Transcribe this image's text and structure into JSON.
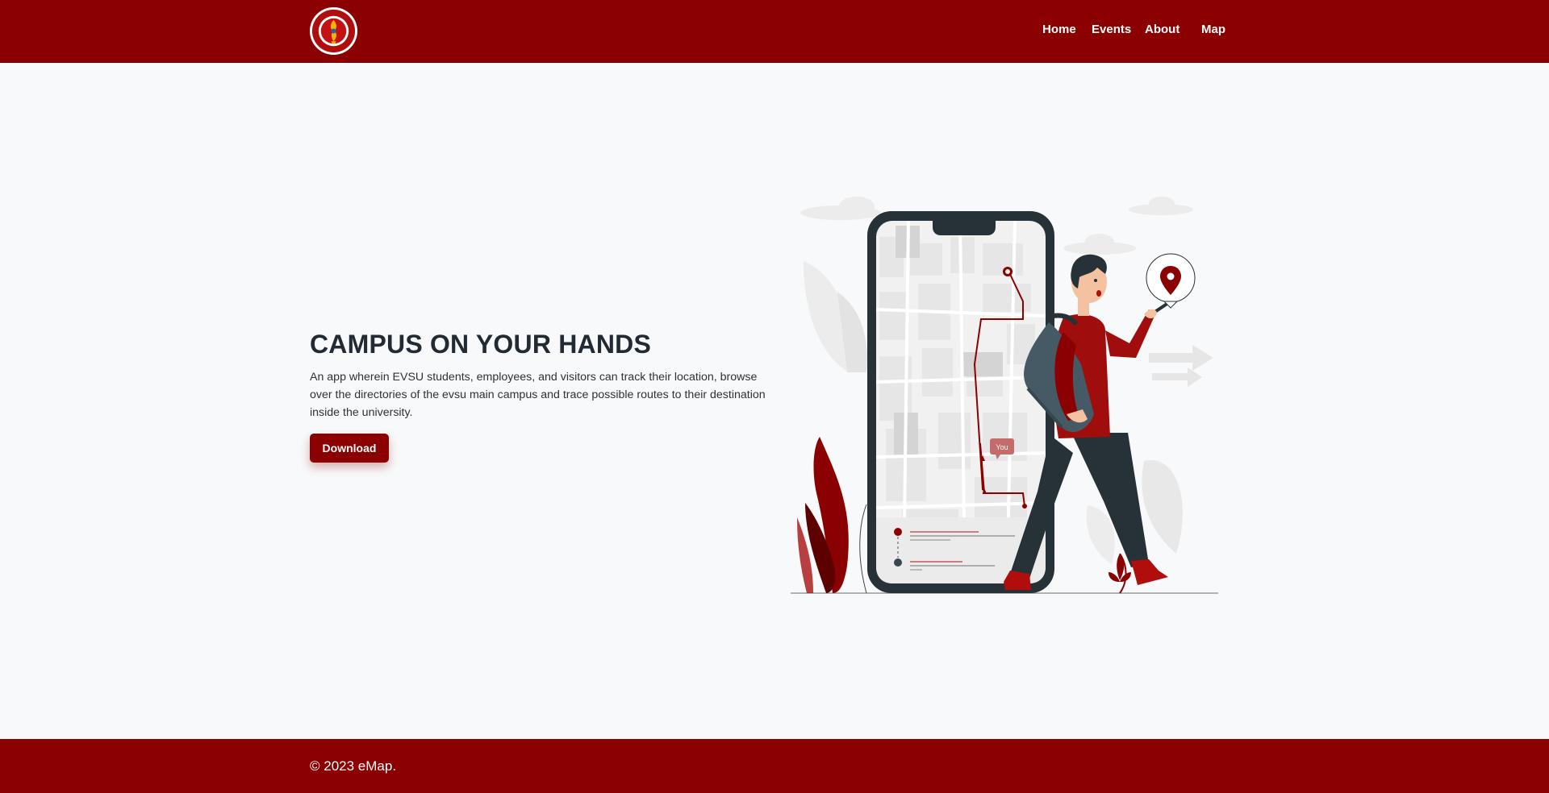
{
  "brand": {
    "logo_icon": "university-seal-logo",
    "primary_color": "#8b0000"
  },
  "nav": {
    "items": [
      {
        "label": "Home"
      },
      {
        "label": "Events"
      },
      {
        "label": "About"
      },
      {
        "label": "Map"
      }
    ]
  },
  "hero": {
    "title": "CAMPUS ON YOUR HANDS",
    "description": "An app wherein EVSU students, employees, and visitors can track their location, browse over the directories of the evsu main campus and trace possible routes to their destination inside the university.",
    "download_label": "Download",
    "illustration": {
      "icon": "person-with-phone-map-illustration",
      "you_label": "You"
    }
  },
  "footer": {
    "copyright": "© 2023 eMap."
  }
}
